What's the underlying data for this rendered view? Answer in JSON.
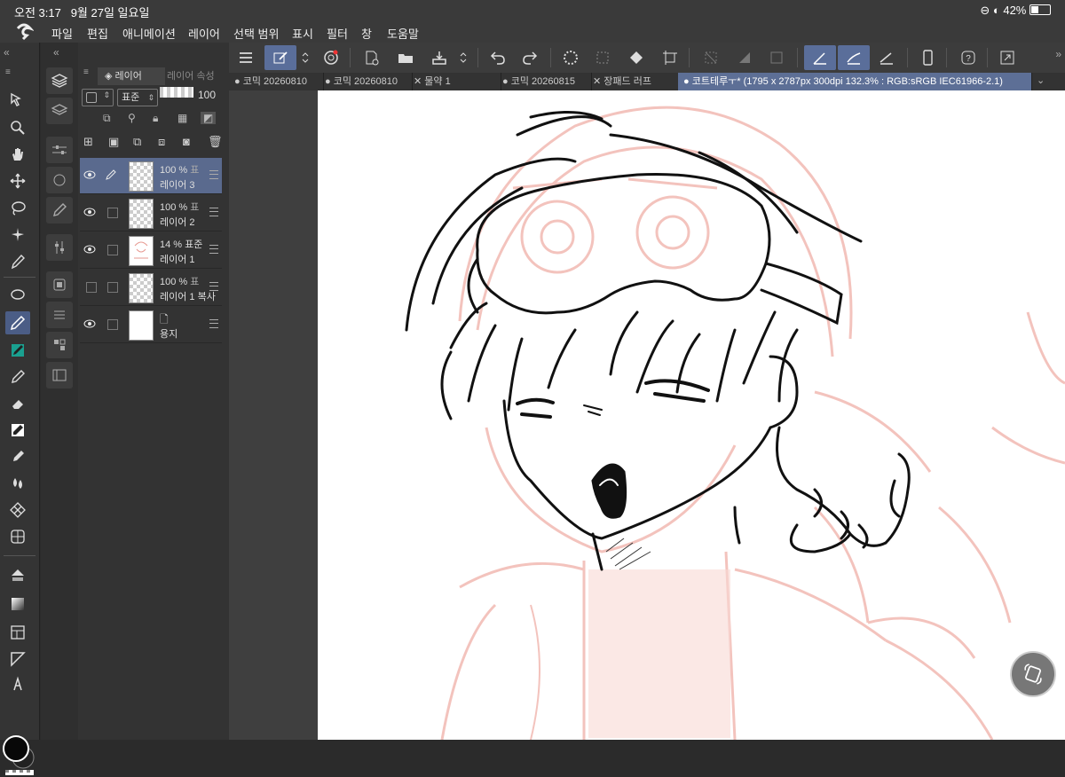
{
  "status": {
    "time": "오전 3:17",
    "date": "9월 27일 일요일",
    "battery": "42%"
  },
  "menu": [
    "파일",
    "편집",
    "애니메이션",
    "레이어",
    "선택 범위",
    "표시",
    "필터",
    "창",
    "도움말"
  ],
  "tabs": [
    "코믹 20260810",
    "코믹 20260810",
    "물약 1",
    "코믹 20260815",
    "장패드 러프",
    "코트테루ㅜ* (1795 x 2787px 300dpi 132.3% : RGB:sRGB IEC61966-2.1)"
  ],
  "layer_panel": {
    "tab_layer": "레이어",
    "tab_property": "레이어 속성",
    "blend_mode": "표준",
    "opacity_value": "100",
    "layers": [
      {
        "opacity": "100 %",
        "mode": "표",
        "name": "레이어 3",
        "selected": true,
        "visible": true
      },
      {
        "opacity": "100 %",
        "mode": "표",
        "name": "레이어 2",
        "selected": false,
        "visible": true
      },
      {
        "opacity": "14 %",
        "mode": "표준",
        "name": "레이어 1",
        "selected": false,
        "visible": true
      },
      {
        "opacity": "100 %",
        "mode": "표",
        "name": "레이어 1 복사",
        "selected": false,
        "visible": false
      },
      {
        "opacity": "",
        "mode": "",
        "name": "용지",
        "selected": false,
        "visible": true
      }
    ]
  },
  "colors": {
    "selected_tool": "#4b5d86",
    "active_tab": "#5d6f96",
    "sketch": "#f3c3bd",
    "line": "#111111"
  }
}
